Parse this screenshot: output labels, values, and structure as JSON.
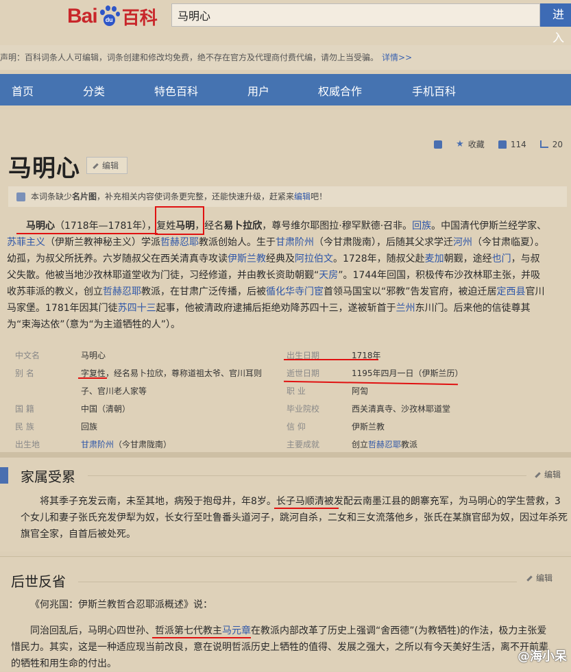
{
  "header": {
    "logo_left": "Bai",
    "logo_paw": "du",
    "logo_right": "百科",
    "search_value": "马明心",
    "search_button": "进入"
  },
  "notice": {
    "text": "声明：百科词条人人可编辑，词条创建和修改均免费，绝不存在官方及代理商付费代编，请勿上当受骗。",
    "details": "详情>>"
  },
  "nav": [
    "首页",
    "分类",
    "特色百科",
    "用户",
    "权威合作",
    "手机百科"
  ],
  "toolbar": {
    "collect": "收藏",
    "likes": "114",
    "shares": "20"
  },
  "title": "马明心",
  "edit_label": "编辑",
  "tip": {
    "pre": "本词条缺少",
    "bold": "名片图",
    "mid": "，补充相关内容使词条更完整，还能快速升级，赶紧来",
    "link": "编辑",
    "post": "吧！"
  },
  "intro": {
    "name": "马明心",
    "dates": "（1718年—1781年），",
    "surname_a": "复姓",
    "surname_b": "马明",
    "s1": "，经名",
    "ibrahim": "易卜拉欣",
    "s2": "，尊号维尔耶图拉·穆罕默德·召非。",
    "hui": "回族",
    "s3": "。中国清代伊斯兰经学家、",
    "sufi": "苏菲主义",
    "s4": "（伊斯兰教神秘主义）学派",
    "jahriyya": "哲赫忍耶",
    "s5": "教派创始人。生于",
    "jieyang": "甘肃阶州",
    "s6": "（今甘肃陇南），后随其父求学迁",
    "hezhou": "河州",
    "s7": "（今甘肃临夏）。幼孤，为叔父所抚养。六岁随叔父在西关清真寺攻读",
    "islam": "伊斯兰教",
    "s8": "经典及",
    "arabic": "阿拉伯文",
    "s9": "。1728年，随叔父赴",
    "yemen": "麦加",
    "s10": "朝觐，途经",
    "yemen2": "也门",
    "s11": "，与叔父失散。他被当地沙孜林耶道堂收为门徒，习经修道，并由教长资助朝觐“",
    "tianfang": "天房",
    "s12": "”。1744年回国，积极传布沙孜林耶主张，并吸收苏菲派的教义，创立",
    "jahriyya2": "哲赫忍耶",
    "s13": "教派，在甘肃广泛传播，后被",
    "xunhua": "循化华寺门宦",
    "s14": "首领马国宝以“邪教”告发官府，被迫迁居",
    "dingxi": "定西县",
    "s15": "官川马家堡。1781年因其门徒",
    "su43": "苏四十三",
    "s16": "起事，他被清政府逮捕后拒绝劝降苏四十三，遂被斩首于",
    "lanzhou": "兰州",
    "s17": "东川门。后来他的信徒尊其为“束海达依”（意为“为主道牺牲的人”）。"
  },
  "infobox": {
    "left": [
      {
        "k": "中文名",
        "v": "马明心"
      },
      {
        "k": "别 名",
        "v_a": "字复性",
        "v_b": "，经名易卜拉欣，尊称道祖太爷、官川耳则",
        "v_c": "子、官川老人家等"
      },
      {
        "k": "国 籍",
        "v": "中国（清朝）"
      },
      {
        "k": "民 族",
        "v": "回族"
      },
      {
        "k": "出生地",
        "v_link": "甘肃阶州",
        "v": "（今甘肃陇南）"
      }
    ],
    "right": [
      {
        "k": "出生日期",
        "v": "1718年"
      },
      {
        "k": "逝世日期",
        "v": "1195年四月一日（伊斯兰历）"
      },
      {
        "k": "职 业",
        "v": "阿訇"
      },
      {
        "k": "毕业院校",
        "v": "西关清真寺、沙孜林耶道堂"
      },
      {
        "k": "信 仰",
        "v": "伊斯兰教"
      },
      {
        "k": "主要成就",
        "v_pre": "创立",
        "v_link": "哲赫忍耶",
        "v": "教派"
      }
    ]
  },
  "section1": {
    "title": "家属受累",
    "edit": "编辑",
    "p_a": "将其季子充发云南，未至其地，病殁于抱母井，年8岁。",
    "p_b": "长子马顺清",
    "p_c": "被发配云南墨江县的朗寨充军，为马明心的学生营救，3个女儿和妻子张氏充发伊犁为奴，长女行至吐鲁番头道河子，跳河自杀，二女和三女流落他乡，张氏在某旗官邸为奴，因过年杀死旗官全家，自首后被处死。"
  },
  "section2": {
    "title": "后世反省",
    "edit": "编辑",
    "quote": "《何兆国：伊斯兰教哲合忍耶派概述》说：",
    "p_a": "同治回乱后，马明心四世孙、",
    "p_b": "哲派第七代教主",
    "p_c": "马元章",
    "p_d": "在教派内部改革了历史上强调“舍西德”(为教牺牲)的作法，极力主张爱惜民力。其实，这是一种适应现当前改良，意在说明哲派历史上牺牲的值得、发展之强大，之所以有今天美好生活，离不开前辈的牺牲和用生命的付出。"
  },
  "watermark": "@海小呆"
}
